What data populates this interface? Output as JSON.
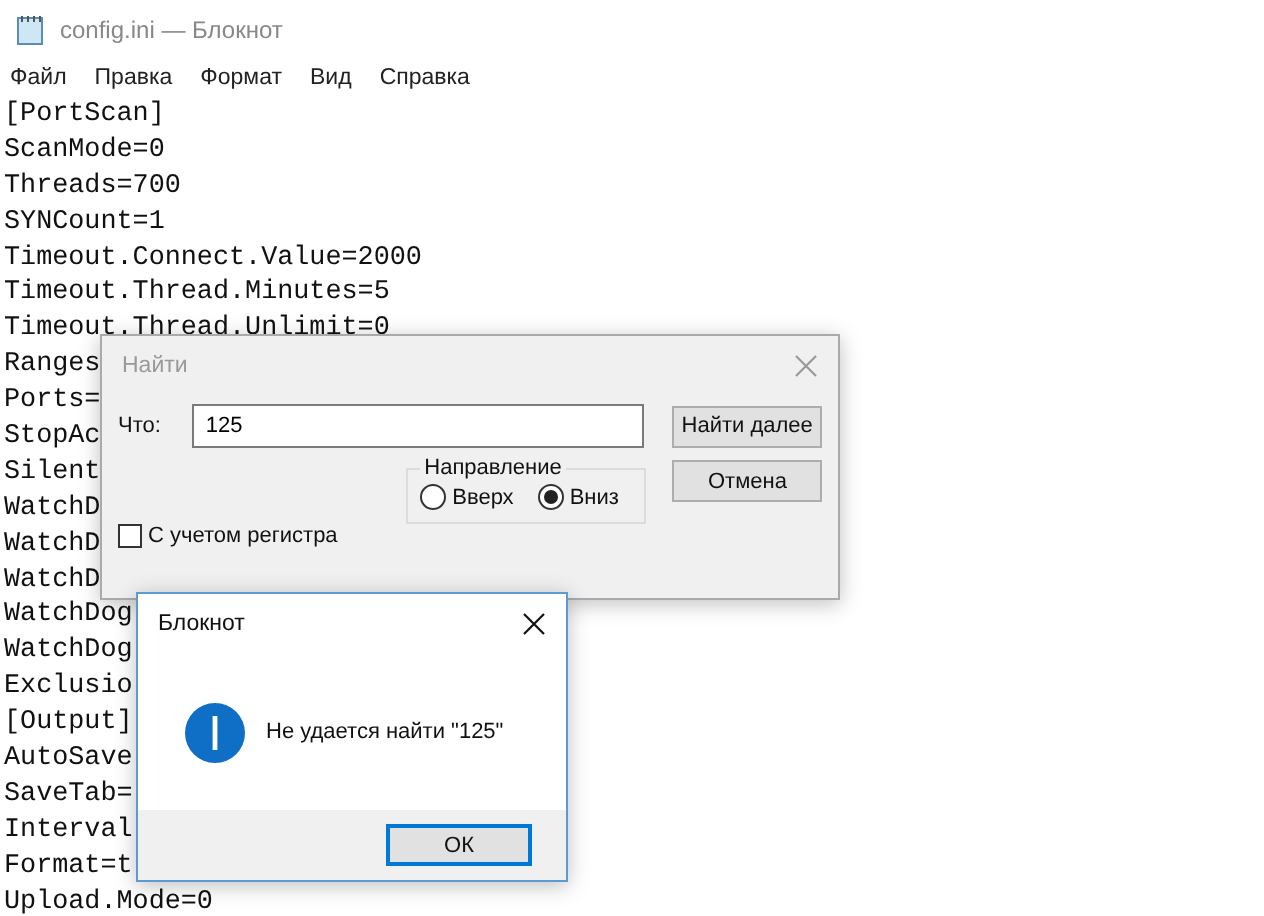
{
  "window": {
    "title": "config.ini — Блокнот"
  },
  "menu": [
    "Файл",
    "Правка",
    "Формат",
    "Вид",
    "Справка"
  ],
  "lines": [
    "[PortScan]",
    "ScanMode=0",
    "Threads=700",
    "SYNCount=1",
    "Timeout.Connect.Value=2000",
    "Timeout.Thread.Minutes=5",
    "Timeout.Thread.Unlimit=0",
    "Ranges",
    "Ports=",
    "StopAc",
    "Silent",
    "WatchD",
    "WatchD",
    "WatchD",
    "WatchDog",
    "WatchDog",
    "Exclusio",
    "[Output]",
    "AutoSave",
    "SaveTab=",
    "Interval",
    "Format=t",
    "Upload.Mode=0"
  ],
  "find_dialog": {
    "title": "Найти",
    "active": false,
    "what_label": "Что:",
    "what_value": "125",
    "match_case": {
      "label": "С учетом регистра",
      "checked": false
    },
    "direction": {
      "label": "Направление",
      "options": [
        {
          "label": "Вверх",
          "selected": false
        },
        {
          "label": "Вниз",
          "selected": true
        }
      ]
    },
    "buttons": [
      {
        "label": "Найти далее",
        "focused": false
      },
      {
        "label": "Отмена",
        "focused": false
      }
    ]
  },
  "message_box": {
    "title": "Блокнот",
    "message": "Не удается найти \"125\"",
    "button": {
      "label": "ОК",
      "focused": true
    }
  }
}
